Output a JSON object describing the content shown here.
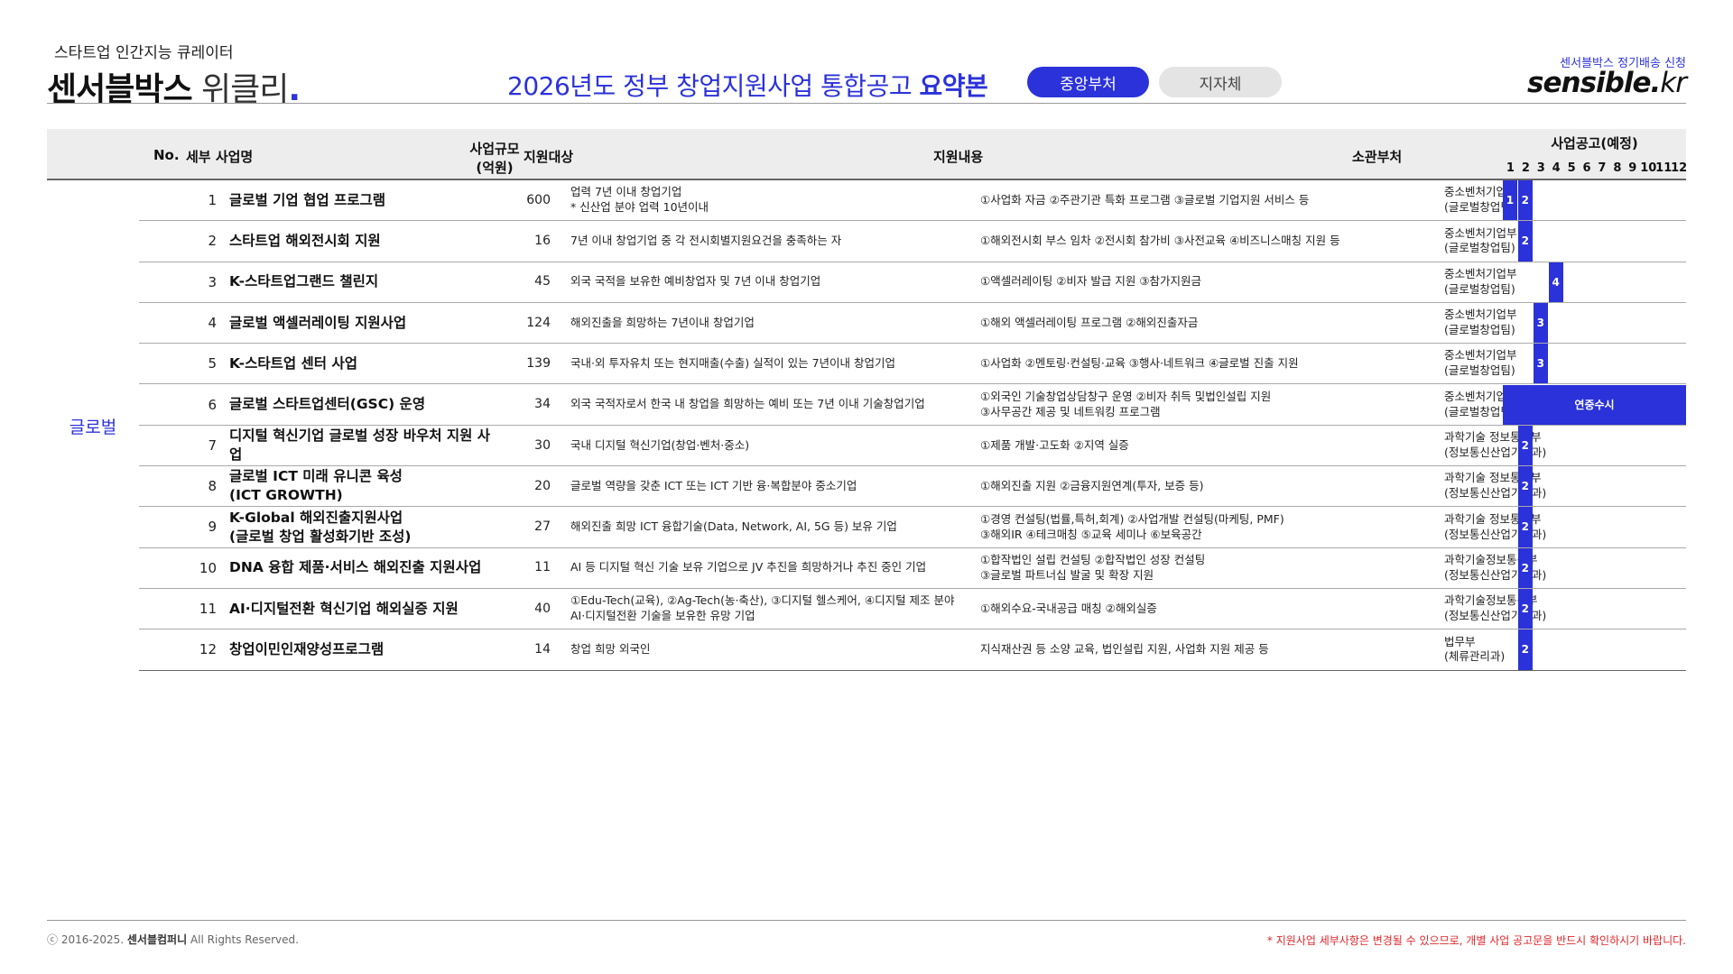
{
  "brand": {
    "subtitle": "스타트업 인간지능 큐레이터",
    "name_bold": "센서블박스",
    "name_light": " 위클리",
    "dot": "."
  },
  "title": {
    "prefix": "2026년도 정부 창업지원사업 통합공고 ",
    "emphasis": "요약본"
  },
  "tabs": [
    {
      "label": "중앙부처",
      "active": true
    },
    {
      "label": "지자체",
      "active": false
    }
  ],
  "subscribe_link": "센서블박스 정기배송 신청",
  "logo": {
    "main": "sensible.",
    "suffix": "kr"
  },
  "table": {
    "headers": {
      "no": "No.",
      "name": "세부 사업명",
      "size_line1": "사업규모",
      "size_line2": "(억원)",
      "target": "지원대상",
      "content": "지원내용",
      "dept": "소관부처",
      "schedule": "사업공고(예정)"
    },
    "months": [
      "1",
      "2",
      "3",
      "4",
      "5",
      "6",
      "7",
      "8",
      "9",
      "10",
      "11",
      "12"
    ],
    "category": "글로벌",
    "rows": [
      {
        "no": "1",
        "name": "글로벌 기업 협업 프로그램",
        "size": "600",
        "target": "업력 7년 이내 창업기업\n* 신산업 분야 업력 10년이내",
        "content": "①사업화 자금 ②주관기관 특화 프로그램 ③글로벌 기업지원 서비스 등",
        "dept": "중소벤처기업부\n(글로벌창업팀)",
        "bars": [
          {
            "month": 1,
            "label": "1"
          },
          {
            "month": 2,
            "label": "2"
          }
        ]
      },
      {
        "no": "2",
        "name": "스타트업 해외전시회 지원",
        "size": "16",
        "target": "7년 이내 창업기업 중 각 전시회별지원요건을 충족하는 자",
        "content": "①해외전시회 부스 임차 ②전시회 참가비 ③사전교육 ④비즈니스매칭 지원 등",
        "dept": "중소벤처기업부\n(글로벌창업팀)",
        "bars": [
          {
            "month": 2,
            "label": "2"
          }
        ]
      },
      {
        "no": "3",
        "name": "K-스타트업그랜드 챌린지",
        "size": "45",
        "target": "외국 국적을 보유한 예비창업자 및 7년 이내 창업기업",
        "content": "①액셀러레이팅 ②비자 발급 지원 ③참가지원금",
        "dept": "중소벤처기업부\n(글로벌창업팀)",
        "bars": [
          {
            "month": 4,
            "label": "4"
          }
        ]
      },
      {
        "no": "4",
        "name": "글로벌 액셀러레이팅 지원사업",
        "size": "124",
        "target": "해외진출을 희망하는 7년이내 창업기업",
        "content": "①해외 액셀러레이팅 프로그램 ②해외진출자금",
        "dept": "중소벤처기업부\n(글로벌창업팀)",
        "bars": [
          {
            "month": 3,
            "label": "3"
          }
        ]
      },
      {
        "no": "5",
        "name": "K-스타트업 센터 사업",
        "size": "139",
        "target": "국내·외 투자유치 또는 현지매출(수출) 실적이 있는 7년이내 창업기업",
        "content": "①사업화 ②멘토링·컨설팅·교육 ③행사·네트워크 ④글로벌 진출 지원",
        "dept": "중소벤처기업부\n(글로벌창업팀)",
        "bars": [
          {
            "month": 3,
            "label": "3"
          }
        ]
      },
      {
        "no": "6",
        "name": "글로벌 스타트업센터(GSC) 운영",
        "size": "34",
        "target": "외국 국적자로서 한국 내 창업을 희망하는 예비 또는 7년 이내 기술창업기업",
        "content": "①외국인 기술창업상담창구 운영 ②비자 취득 및법인설립 지원\n③사무공간 제공 및 네트워킹 프로그램",
        "dept": "중소벤처기업부\n(글로벌창업팀)",
        "bars": [
          {
            "month": 1,
            "span": 12,
            "label": "연중수시"
          }
        ]
      },
      {
        "no": "7",
        "name": "디지털 혁신기업 글로벌 성장 바우처 지원 사업",
        "size": "30",
        "target": "국내 디지털 혁신기업(창업·벤처·중소)",
        "content": "①제품 개발·고도화 ②지역 실증",
        "dept": "과학기술 정보통신부\n(정보통신산업기반과)",
        "bars": [
          {
            "month": 2,
            "label": "2"
          }
        ]
      },
      {
        "no": "8",
        "name": "글로벌 ICT 미래 유니콘 육성\n (ICT GROWTH)",
        "size": "20",
        "target": "글로벌 역량을 갖춘 ICT 또는 ICT 기반 융·복합분야 중소기업",
        "content": "①해외진출 지원 ②금융지원연계(투자, 보증 등)",
        "dept": "과학기술 정보통신부\n(정보통신산업기반과)",
        "bars": [
          {
            "month": 2,
            "label": "2"
          }
        ]
      },
      {
        "no": "9",
        "name": "K-Global 해외진출지원사업\n(글로벌 창업 활성화기반 조성)",
        "size": "27",
        "target": "해외진출 희망 ICT 융합기술(Data, Network, AI, 5G 등) 보유 기업",
        "content": "①경영 컨설팅(법률,특허,회계) ②사업개발 컨설팅(마케팅, PMF)\n③해외IR ④테크매칭 ⑤교육 세미나 ⑥보육공간",
        "dept": "과학기술 정보통신부\n(정보통신산업기반과)",
        "bars": [
          {
            "month": 2,
            "label": "2"
          }
        ]
      },
      {
        "no": "10",
        "name": "DNA 융합 제품·서비스 해외진출 지원사업",
        "size": "11",
        "target": "AI 등 디지털 혁신 기술 보유 기업으로 JV 추진을 희망하거나 추진 중인 기업",
        "content": "①합작법인 설립 컨설팅 ②합작법인 성장 컨설팅\n③글로벌 파트너십 발굴 및 확장 지원",
        "dept": "과학기술정보통신부\n(정보통신산업기반과)",
        "bars": [
          {
            "month": 2,
            "label": "2"
          }
        ]
      },
      {
        "no": "11",
        "name": "AI·디지털전환 혁신기업 해외실증 지원",
        "size": "40",
        "target": "①Edu-Tech(교육), ②Ag-Tech(농·축산), ③디지털 헬스케어, ④디지털 제조 분야 AI·디지털전환 기술을 보유한 유망  기업",
        "content": "①해외수요-국내공급 매칭 ②해외실증",
        "dept": "과학기술정보통신부\n(정보통신산업기반과)",
        "bars": [
          {
            "month": 2,
            "label": "2"
          }
        ]
      },
      {
        "no": "12",
        "name": "창업이민인재양성프로그램",
        "size": "14",
        "target": "창업 희망 외국인",
        "content": "지식재산권 등 소양 교육, 법인설립 지원, 사업화 지원 제공 등",
        "dept": "법무부\n(체류관리과)",
        "bars": [
          {
            "month": 2,
            "label": "2"
          }
        ]
      }
    ]
  },
  "footer": {
    "copyright_prefix": "ⓒ 2016-2025.",
    "company": "센서블컴퍼니",
    "rights": "All Rights Reserved.",
    "notice": "* 지원사업 세부사항은 변경될 수 있으므로, 개별 사업 공고문을 반드시 확인하시기 바랍니다."
  },
  "colors": {
    "accent": "#2b32d9",
    "notice": "#e0262a"
  }
}
